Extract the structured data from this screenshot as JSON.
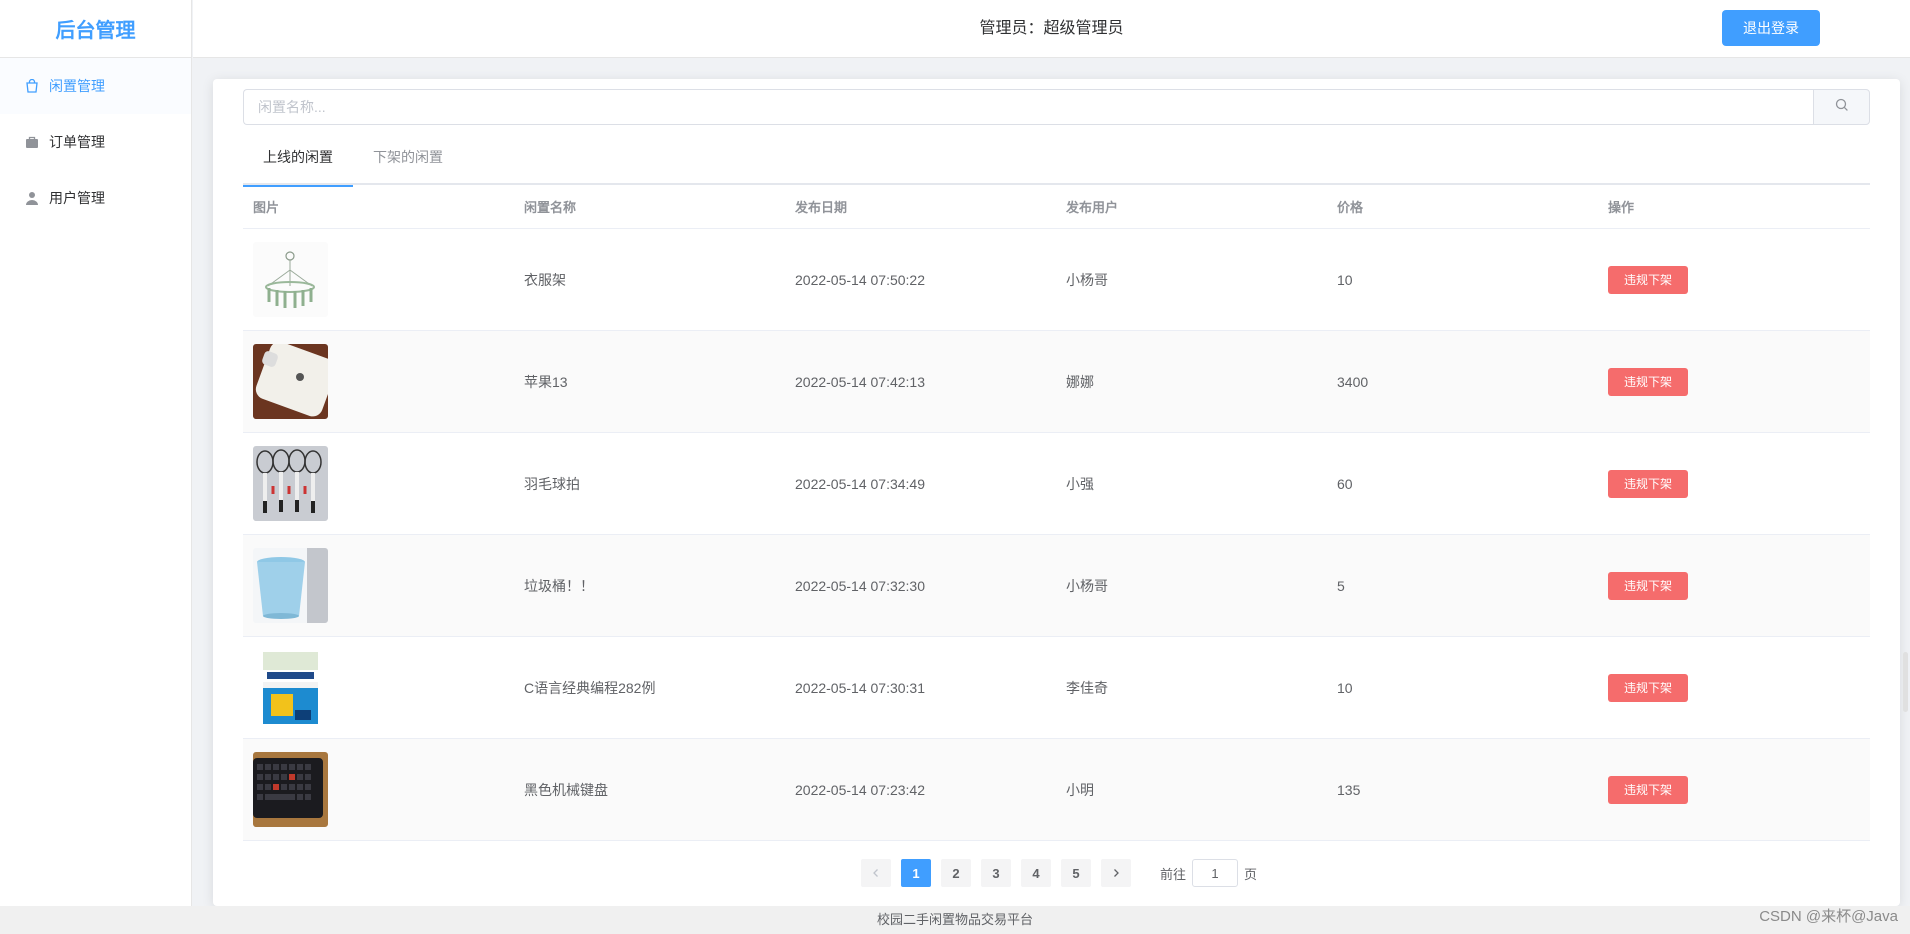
{
  "sidebar": {
    "brand": "后台管理",
    "items": [
      {
        "label": "闲置管理",
        "icon": "bag-icon",
        "active": true
      },
      {
        "label": "订单管理",
        "icon": "briefcase-icon",
        "active": false
      },
      {
        "label": "用户管理",
        "icon": "user-icon",
        "active": false
      }
    ]
  },
  "header": {
    "admin_text": "管理员：超级管理员",
    "logout_label": "退出登录"
  },
  "search": {
    "placeholder": "闲置名称...",
    "value": ""
  },
  "tabs": [
    {
      "label": "上线的闲置",
      "active": true
    },
    {
      "label": "下架的闲置",
      "active": false
    }
  ],
  "table": {
    "columns": [
      "图片",
      "闲置名称",
      "发布日期",
      "发布用户",
      "价格",
      "操作"
    ],
    "rows": [
      {
        "image": "clothes-hanger",
        "name": "衣服架",
        "date": "2022-05-14 07:50:22",
        "user": "小杨哥",
        "price": "10",
        "action": "违规下架"
      },
      {
        "image": "white-iphone",
        "name": "苹果13",
        "date": "2022-05-14 07:42:13",
        "user": "娜娜",
        "price": "3400",
        "action": "违规下架"
      },
      {
        "image": "badminton-rackets",
        "name": "羽毛球拍",
        "date": "2022-05-14 07:34:49",
        "user": "小强",
        "price": "60",
        "action": "违规下架"
      },
      {
        "image": "trash-bin",
        "name": "垃圾桶！！",
        "date": "2022-05-14 07:32:30",
        "user": "小杨哥",
        "price": "5",
        "action": "违规下架"
      },
      {
        "image": "c-book",
        "name": "C语言经典编程282例",
        "date": "2022-05-14 07:30:31",
        "user": "李佳奇",
        "price": "10",
        "action": "违规下架"
      },
      {
        "image": "black-keyboard",
        "name": "黑色机械键盘",
        "date": "2022-05-14 07:23:42",
        "user": "小明",
        "price": "135",
        "action": "违规下架"
      }
    ]
  },
  "pagination": {
    "pages": [
      "1",
      "2",
      "3",
      "4",
      "5"
    ],
    "current": "1",
    "goto_prefix": "前往",
    "goto_value": "1",
    "goto_suffix": "页"
  },
  "footer": {
    "text": "校园二手闲置物品交易平台",
    "watermark": "CSDN @来杯@Java"
  },
  "colors": {
    "primary": "#409EFF",
    "danger": "#F56C6C"
  }
}
